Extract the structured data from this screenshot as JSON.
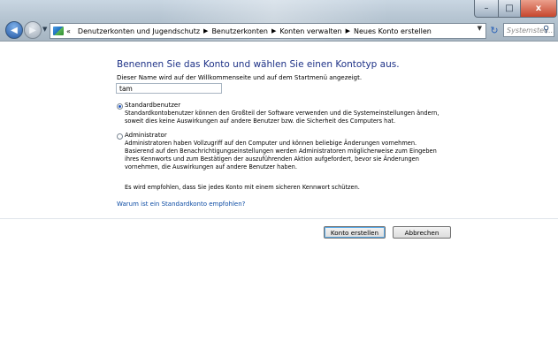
{
  "window": {
    "breadcrumb": [
      "Denutzerkonten und Jugendschutz",
      "Benutzerkonten",
      "Konten verwalten",
      "Neues Konto erstellen"
    ],
    "breadcrumb_prefix": "«",
    "search_placeholder": "Systemsteu..."
  },
  "form": {
    "heading": "Benennen Sie das Konto und wählen Sie einen Kontotyp aus.",
    "name_label": "Dieser Name wird auf der Willkommenseite und auf dem Startmenü angezeigt.",
    "name_value": "tam",
    "options": [
      {
        "title": "Standardbenutzer",
        "checked": true,
        "description": "Standardkontobenutzer können den Großteil der Software verwenden und die Systemeinstellungen ändern, soweit dies keine Auswirkungen auf andere Benutzer bzw. die Sicherheit des Computers hat."
      },
      {
        "title": "Administrator",
        "checked": false,
        "description": "Administratoren haben Vollzugriff auf den Computer und können beliebige Änderungen vornehmen. Basierend auf den Benachrichtigungseinstellungen werden Administratoren möglicherweise zum Eingeben ihres Kennworts und zum Bestätigen der auszuführenden Aktion aufgefordert, bevor sie Änderungen vornehmen, die Auswirkungen auf andere Benutzer haben."
      }
    ],
    "recommendation": "Es wird empfohlen, dass Sie jedes Konto mit einem sicheren Kennwort schützen.",
    "help_link": "Warum ist ein Standardkonto empfohlen?"
  },
  "buttons": {
    "create": "Konto erstellen",
    "cancel": "Abbrechen"
  },
  "icons": {
    "back": "back-arrow-icon",
    "forward": "forward-arrow-icon",
    "refresh": "refresh-icon",
    "search": "search-icon",
    "control_panel": "control-panel-icon"
  },
  "colors": {
    "heading": "#1e3287",
    "link": "#0a4aa3",
    "close_button": "#c6462d"
  }
}
